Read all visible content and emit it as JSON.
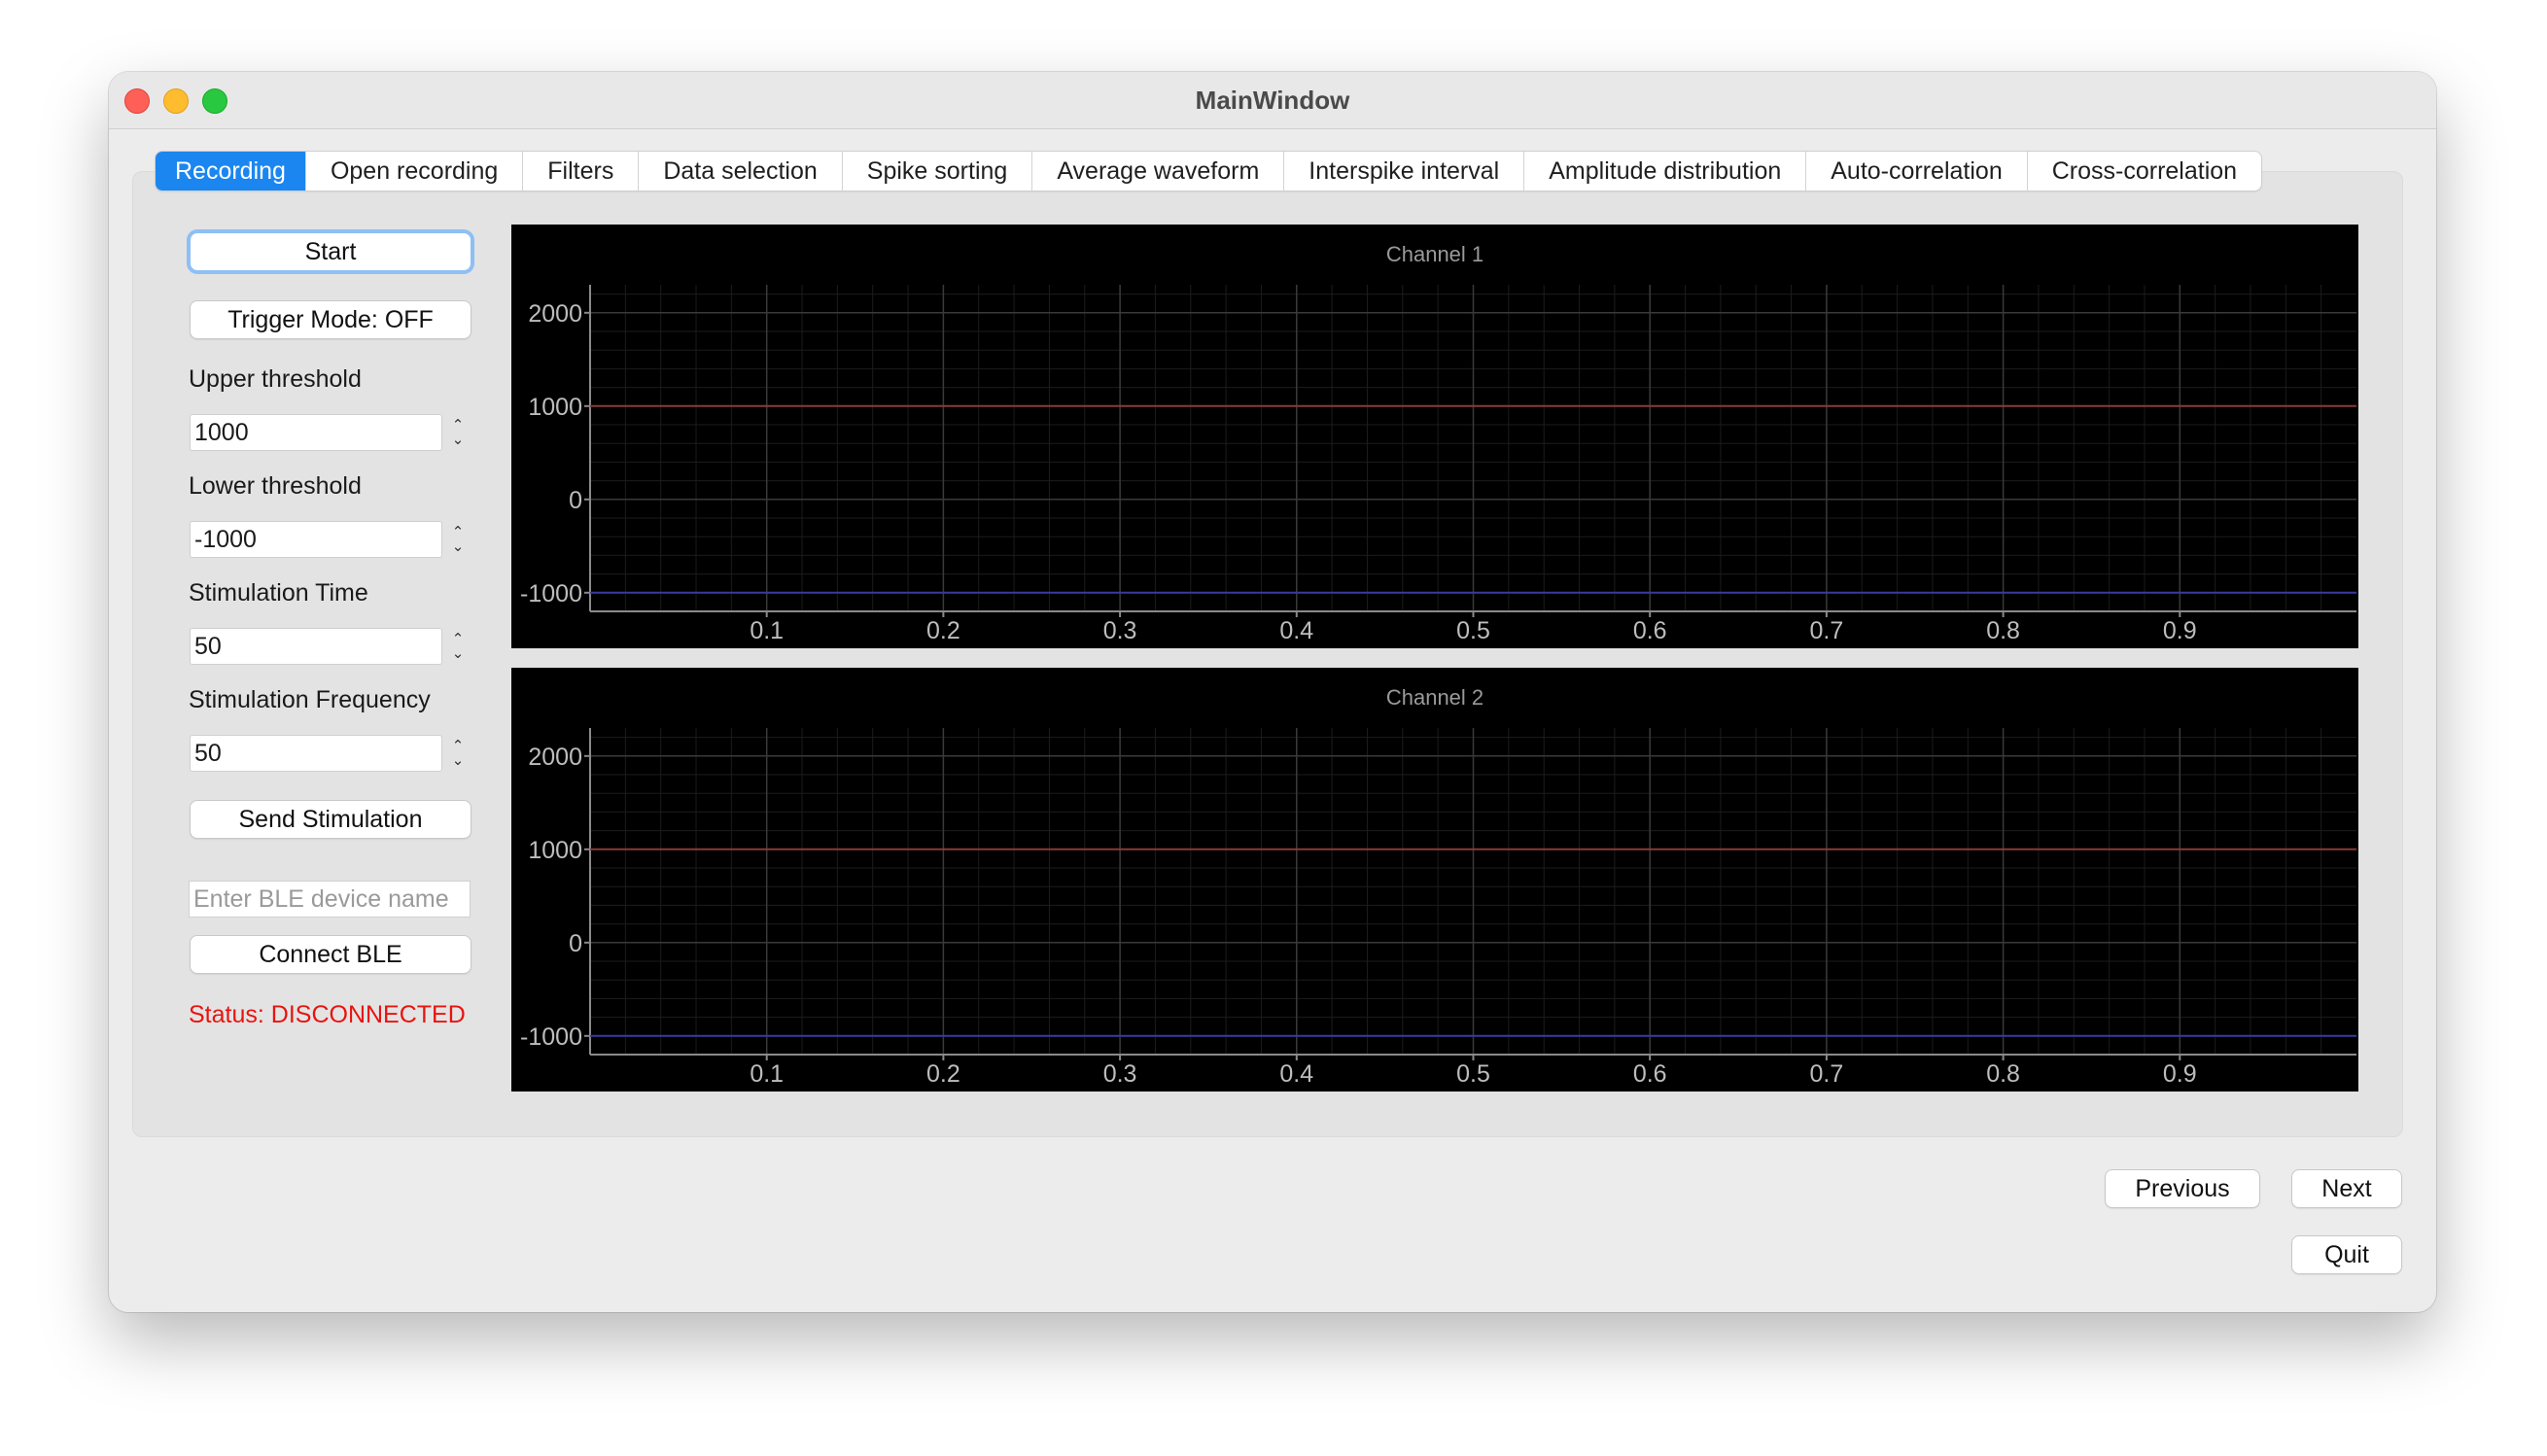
{
  "window": {
    "title": "MainWindow"
  },
  "tabs": [
    {
      "label": "Recording",
      "active": true
    },
    {
      "label": "Open recording"
    },
    {
      "label": "Filters"
    },
    {
      "label": "Data selection"
    },
    {
      "label": "Spike sorting"
    },
    {
      "label": "Average waveform"
    },
    {
      "label": "Interspike interval"
    },
    {
      "label": "Amplitude distribution"
    },
    {
      "label": "Auto-correlation"
    },
    {
      "label": "Cross-correlation"
    }
  ],
  "controls": {
    "start_label": "Start",
    "trigger_label": "Trigger Mode: OFF",
    "upper_threshold": {
      "label": "Upper threshold",
      "value": "1000"
    },
    "lower_threshold": {
      "label": "Lower threshold",
      "value": "-1000"
    },
    "stim_time": {
      "label": "Stimulation Time",
      "value": "50"
    },
    "stim_freq": {
      "label": "Stimulation Frequency",
      "value": "50"
    },
    "send_stim_label": "Send Stimulation",
    "ble_placeholder": "Enter BLE device name",
    "connect_ble_label": "Connect BLE",
    "status_text": "Status: DISCONNECTED",
    "status_color": "#e8140f"
  },
  "footer": {
    "previous_label": "Previous",
    "next_label": "Next",
    "quit_label": "Quit"
  },
  "chart_data": [
    {
      "type": "line",
      "title": "Channel 1",
      "xlim": [
        0,
        1
      ],
      "ylim": [
        -1200,
        2300
      ],
      "xticks": [
        0.1,
        0.2,
        0.3,
        0.4,
        0.5,
        0.6,
        0.7,
        0.8,
        0.9
      ],
      "yticks": [
        -1000,
        0,
        1000,
        2000
      ],
      "grid": true,
      "series": [
        {
          "x": [
            0,
            1
          ],
          "y": [
            1000,
            1000
          ],
          "color": "#8a3a3a"
        },
        {
          "x": [
            0,
            1
          ],
          "y": [
            -1000,
            -1000
          ],
          "color": "#3a3aa0"
        }
      ]
    },
    {
      "type": "line",
      "title": "Channel 2",
      "xlim": [
        0,
        1
      ],
      "ylim": [
        -1200,
        2300
      ],
      "xticks": [
        0.1,
        0.2,
        0.3,
        0.4,
        0.5,
        0.6,
        0.7,
        0.8,
        0.9
      ],
      "yticks": [
        -1000,
        0,
        1000,
        2000
      ],
      "grid": true,
      "series": [
        {
          "x": [
            0,
            1
          ],
          "y": [
            1000,
            1000
          ],
          "color": "#8a3a3a"
        },
        {
          "x": [
            0,
            1
          ],
          "y": [
            -1000,
            -1000
          ],
          "color": "#3a3aa0"
        }
      ]
    }
  ]
}
